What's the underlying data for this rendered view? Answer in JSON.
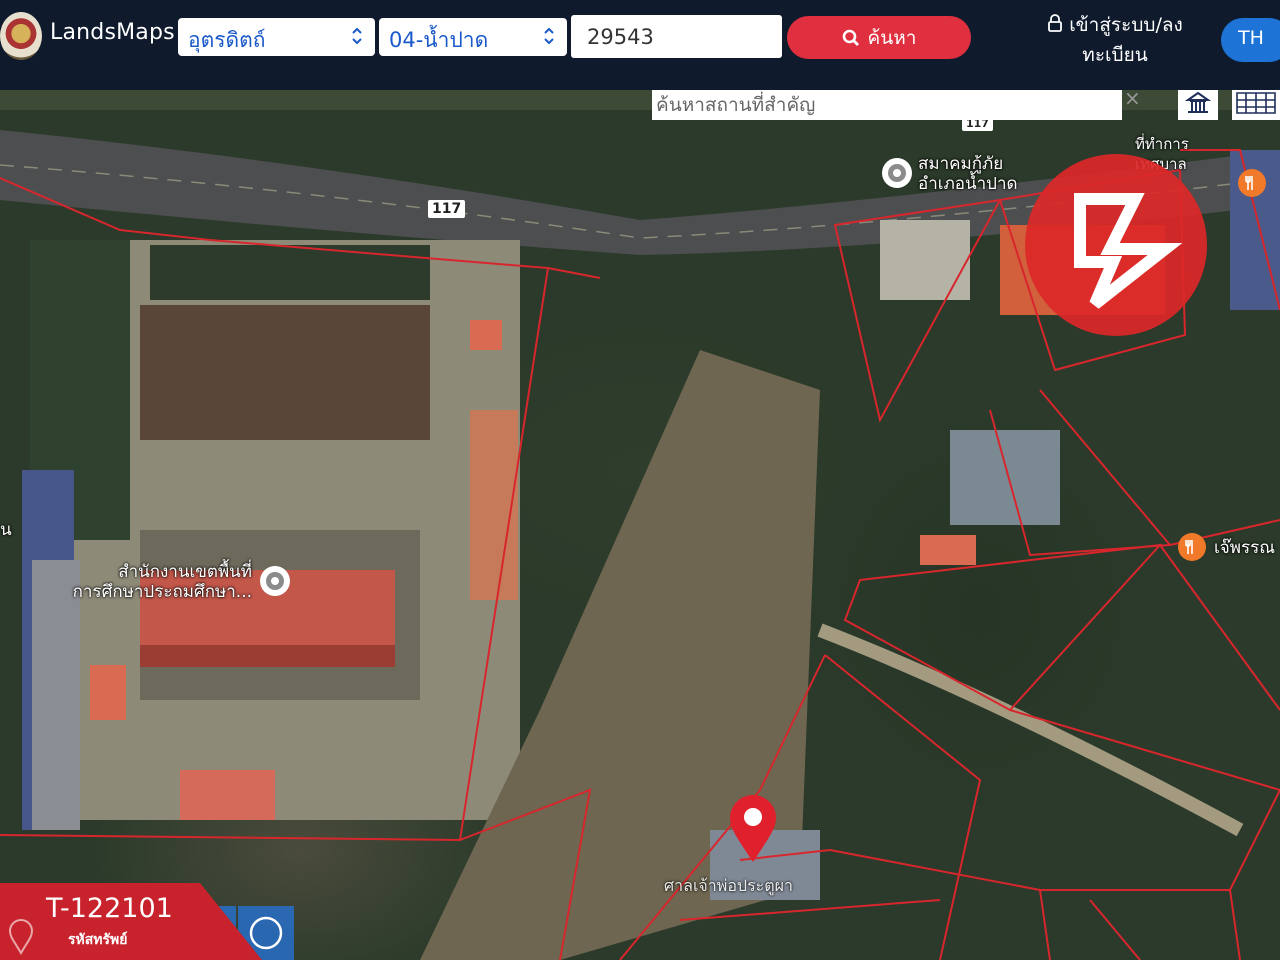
{
  "header": {
    "brand": "LandsMaps",
    "province_select": "อุตรดิตถ์",
    "district_select": "04-น้ำปาด",
    "parcel_number": "29543",
    "search_label": "ค้นหา",
    "login_label": "เข้าสู่ระบบ/ลงทะเบียน",
    "language": "TH"
  },
  "map": {
    "landmark_search_placeholder": "ค้นหาสถานที่สำคัญ",
    "landmark_clear": "×",
    "route_shield": "117",
    "route_shield_small": "117",
    "places": [
      {
        "name_line1": "สมาคมกู้ภัย",
        "name_line2": "อำเภอน้ำปาด"
      },
      {
        "name_line1": "สำนักงานเขตพื้นที่",
        "name_line2": "การศึกษาประถมศึกษา..."
      },
      {
        "name_line1": "เจ๊พรรณ"
      },
      {
        "name_line1": "ศาลเจ้าพ่อประตูผา"
      },
      {
        "name_line1": "ที่ทำการ",
        "name_line2": "เทศบาล"
      },
      {
        "name_line1": "น"
      }
    ],
    "icons": [
      "pin-icon",
      "restaurant-icon",
      "building-icon",
      "grid-icon",
      "circle-draw-icon",
      "polygon-draw-icon",
      "marker-draw-icon"
    ]
  },
  "asset": {
    "id": "T-122101",
    "caption": "รหัสทรัพย์"
  },
  "colors": {
    "header_bg": "#0f1b2d",
    "search_button": "#e0303f",
    "language_button": "#1e74d6",
    "parcel_border": "#d8262d",
    "watermark": "#dc2828",
    "asset_tag": "#c8232c"
  }
}
